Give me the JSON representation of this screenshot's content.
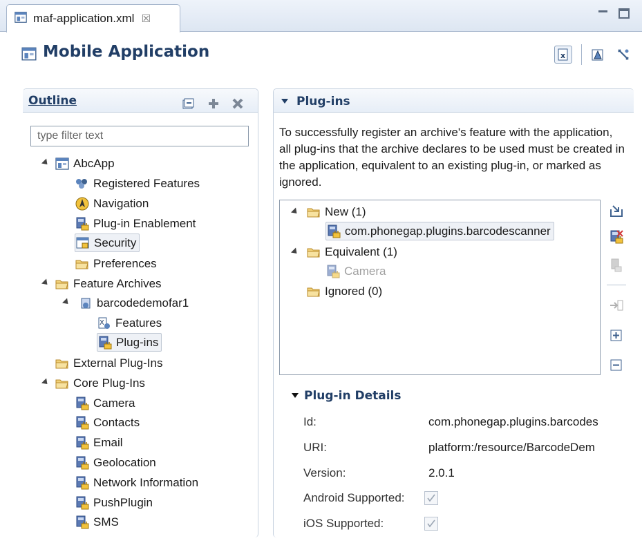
{
  "tab": {
    "label": "maf-application.xml",
    "close": "☒"
  },
  "header": {
    "title": "Mobile Application"
  },
  "outline": {
    "title": "Outline",
    "filter_placeholder": "type filter text",
    "tree": [
      {
        "label": "AbcApp",
        "icon": "app-icon"
      },
      {
        "label": "Registered Features",
        "icon": "features-icon"
      },
      {
        "label": "Navigation",
        "icon": "navigation-icon"
      },
      {
        "label": "Plug-in Enablement",
        "icon": "plugin-enablement-icon"
      },
      {
        "label": "Security",
        "icon": "security-icon"
      },
      {
        "label": "Preferences",
        "icon": "folder-icon"
      },
      {
        "label": "Feature Archives",
        "icon": "folder-icon"
      },
      {
        "label": "barcodedemofar1",
        "icon": "archive-icon"
      },
      {
        "label": "Features",
        "icon": "features-icon"
      },
      {
        "label": "Plug-ins",
        "icon": "plugin-icon"
      },
      {
        "label": "External Plug-Ins",
        "icon": "folder-icon"
      },
      {
        "label": "Core Plug-Ins",
        "icon": "folder-icon"
      },
      {
        "label": "Camera",
        "icon": "plugin-icon"
      },
      {
        "label": "Contacts",
        "icon": "plugin-icon"
      },
      {
        "label": "Email",
        "icon": "plugin-icon"
      },
      {
        "label": "Geolocation",
        "icon": "plugin-icon"
      },
      {
        "label": "Network Information",
        "icon": "plugin-icon"
      },
      {
        "label": "PushPlugin",
        "icon": "plugin-icon"
      },
      {
        "label": "SMS",
        "icon": "plugin-icon"
      }
    ]
  },
  "plugins": {
    "title": "Plug-ins",
    "description": "To successfully register an archive's feature with the application, all plug-ins that the archive  declares to be used must be created in the application, equivalent to an existing plug-in, or marked as ignored.",
    "tree": [
      {
        "label": "New (1)",
        "icon": "folder-icon"
      },
      {
        "label": "com.phonegap.plugins.barcodescanner",
        "icon": "plugin-icon"
      },
      {
        "label": "Equivalent (1)",
        "icon": "folder-icon"
      },
      {
        "label": "Camera",
        "icon": "plugin-icon"
      },
      {
        "label": "Ignored (0)",
        "icon": "folder-icon"
      }
    ]
  },
  "details": {
    "title": "Plug-in Details",
    "id_label": "Id:",
    "id_value": "com.phonegap.plugins.barcodes",
    "uri_label": "URI:",
    "uri_value": "platform:/resource/BarcodeDem",
    "version_label": "Version:",
    "version_value": "2.0.1",
    "android_label": "Android Supported:",
    "android_checked": true,
    "ios_label": "iOS Supported:",
    "ios_checked": true
  }
}
